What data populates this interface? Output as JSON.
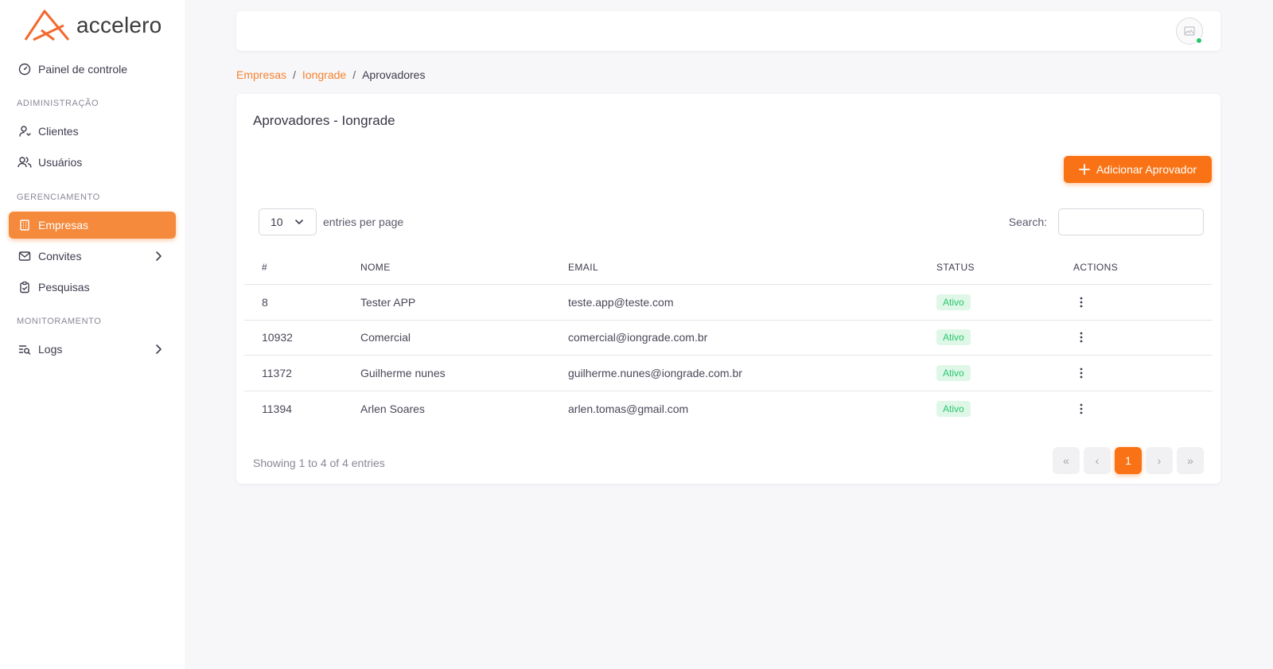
{
  "app": {
    "brand": "accelero",
    "accent": "#f97316"
  },
  "sidebar": {
    "dashboard": {
      "label": "Painel de controle",
      "icon": "gauge-icon"
    },
    "sections": {
      "admin": "ADIMINISTRAÇÃO",
      "management": "GERENCIAMENTO",
      "monitoring": "MONITORAMENTO"
    },
    "items": {
      "clientes": {
        "label": "Clientes",
        "icon": "user-icon"
      },
      "usuarios": {
        "label": "Usuários",
        "icon": "users-icon"
      },
      "empresas": {
        "label": "Empresas",
        "icon": "building-icon"
      },
      "convites": {
        "label": "Convites",
        "icon": "mail-icon"
      },
      "pesquisas": {
        "label": "Pesquisas",
        "icon": "clipboard-check-icon"
      },
      "logs": {
        "label": "Logs",
        "icon": "list-search-icon"
      }
    }
  },
  "breadcrumb": {
    "crumb1": "Empresas",
    "crumb2": "Iongrade",
    "current": "Aprovadores",
    "sep": "/"
  },
  "card": {
    "title": "Aprovadores - Iongrade",
    "add_button": "Adicionar Aprovador",
    "entries_value": "10",
    "entries_label": "entries per page",
    "search_label": "Search:",
    "search_value": "",
    "columns": [
      "#",
      "NOME",
      "EMAIL",
      "STATUS",
      "ACTIONS"
    ],
    "rows": [
      {
        "id": "8",
        "nome": "Tester APP",
        "email": "teste.app@teste.com",
        "status": "Ativo"
      },
      {
        "id": "10932",
        "nome": "Comercial",
        "email": "comercial@iongrade.com.br",
        "status": "Ativo"
      },
      {
        "id": "11372",
        "nome": "Guilherme nunes",
        "email": "guilherme.nunes@iongrade.com.br",
        "status": "Ativo"
      },
      {
        "id": "11394",
        "nome": "Arlen Soares",
        "email": "arlen.tomas@gmail.com",
        "status": "Ativo"
      }
    ],
    "showing": "Showing 1 to 4 of 4 entries",
    "pager": {
      "first": "«",
      "prev": "‹",
      "current": "1",
      "next": "›",
      "last": "»"
    }
  }
}
